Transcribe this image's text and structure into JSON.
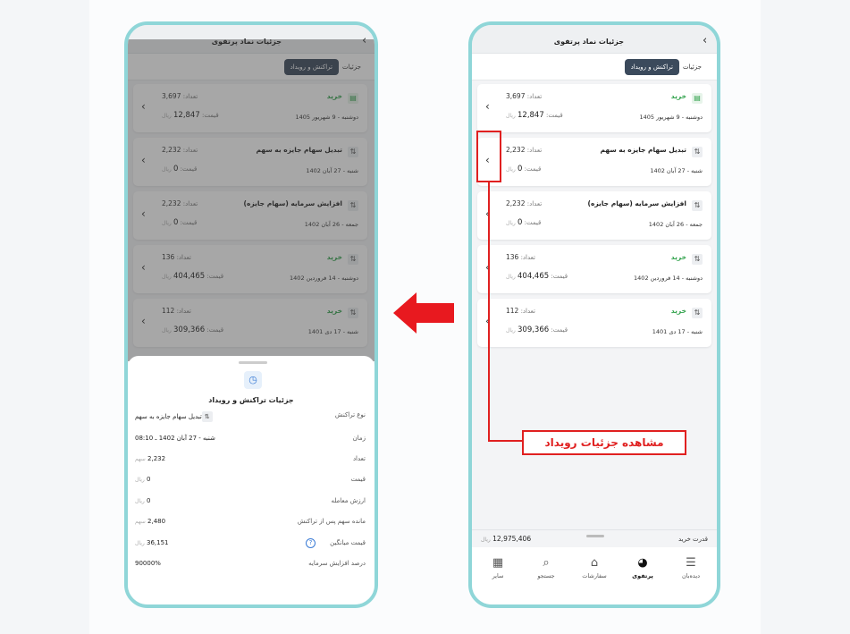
{
  "screen_title": "جزئیات نماد پرتفوی",
  "tabs": [
    {
      "label": "جزئیات",
      "active": false
    },
    {
      "label": "تراکنش و رویداد",
      "active": true
    }
  ],
  "events": [
    {
      "type": "خرید",
      "color": "green",
      "icon": "receipt-icon",
      "date": "دوشنبه - 9 شهریور 1405",
      "count_label": "تعداد:",
      "count": "3,697",
      "price_label": "قیمت:",
      "price": "12,847",
      "currency": "ریال"
    },
    {
      "type": "تبدیل سهام جایزه به سهم",
      "color": "dark",
      "icon": "swap-icon",
      "date": "شنبه - 27 آبان 1402",
      "count_label": "تعداد:",
      "count": "2,232",
      "price_label": "قیمت:",
      "price": "0",
      "currency": "ریال"
    },
    {
      "type": "افزایش سرمایه (سهام جایزه)",
      "color": "dark",
      "icon": "swap-icon",
      "date": "جمعه - 26 آبان 1402",
      "count_label": "تعداد:",
      "count": "2,232",
      "price_label": "قیمت:",
      "price": "0",
      "currency": "ریال"
    },
    {
      "type": "خرید",
      "color": "green",
      "icon": "swap-icon",
      "date": "دوشنبه - 14 فروردین 1402",
      "count_label": "تعداد:",
      "count": "136",
      "price_label": "قیمت:",
      "price": "404,465",
      "currency": "ریال"
    },
    {
      "type": "خرید",
      "color": "green",
      "icon": "swap-icon",
      "date": "شنبه - 17 دی 1401",
      "count_label": "تعداد:",
      "count": "112",
      "price_label": "قیمت:",
      "price": "309,366",
      "currency": "ریال"
    }
  ],
  "buy_power": {
    "label": "قدرت خرید",
    "value": "12,975,406",
    "currency": "ریال"
  },
  "nav": [
    {
      "label": "دیده‌بان",
      "icon": "watchlist-icon",
      "active": false
    },
    {
      "label": "پرتفوی",
      "icon": "pie-chart-icon",
      "active": true
    },
    {
      "label": "سفارشات",
      "icon": "basket-icon",
      "active": false
    },
    {
      "label": "جستجو",
      "icon": "search-icon",
      "active": false
    },
    {
      "label": "سایر",
      "icon": "grid-icon",
      "active": false
    }
  ],
  "sheet": {
    "title": "جزئیات تراکنش و رویداد",
    "rows": [
      {
        "key": "نوع تراکنش",
        "value": "تبدیل سهام جایزه به سهم",
        "unit": ""
      },
      {
        "key": "زمان",
        "value": "شنبه - 27 آبان 1402 ـ 08:10",
        "unit": ""
      },
      {
        "key": "تعداد",
        "value": "2,232",
        "unit": "سهم"
      },
      {
        "key": "قیمت",
        "value": "0",
        "unit": "ریال"
      },
      {
        "key": "ارزش معامله",
        "value": "0",
        "unit": "ریال"
      },
      {
        "key": "مانده سهم پس از تراکنش",
        "value": "2,480",
        "unit": "سهم"
      },
      {
        "key": "قیمت میانگین",
        "value": "36,151",
        "unit": "ریال"
      },
      {
        "key": "درصد افزایش سرمایه",
        "value": "90000%",
        "unit": ""
      }
    ]
  },
  "callout": "مشاهده جزئیات رویداد",
  "colors": {
    "highlight": "#e02020",
    "phone_border": "#8fd6d8",
    "active_tab": "#3b4a5c",
    "buy_green": "#2fa14a"
  }
}
